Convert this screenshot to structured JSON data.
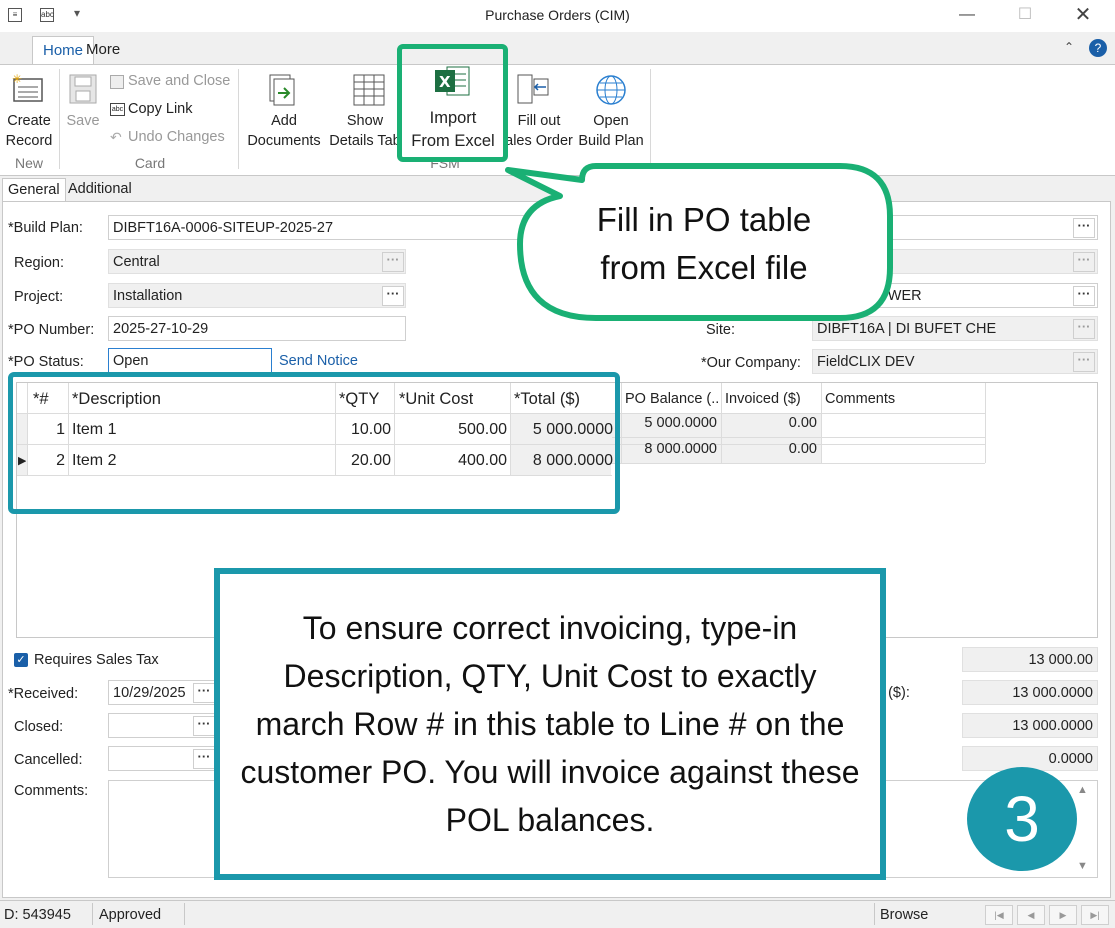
{
  "window": {
    "title": "Purchase Orders (CIM)"
  },
  "ribbon": {
    "tabs": [
      "Home",
      "More"
    ],
    "buttons": {
      "create_record": "Create\nRecord",
      "save": "Save",
      "save_and_close": "Save and Close",
      "copy_link": "Copy Link",
      "undo_changes": "Undo Changes",
      "add_documents": "Add\nDocuments",
      "show_details_table": "Show\nDetails Tab",
      "import_from_excel": "Import\nFrom Excel",
      "fill_out_sales_order": "Fill out\nales Order",
      "open_build_plan": "Open\nBuild Plan"
    },
    "groups": {
      "new": "New",
      "card": "Card",
      "fsm": "FSM"
    }
  },
  "form_tabs": [
    "General",
    "Additional"
  ],
  "form": {
    "build_plan_label": "*Build Plan:",
    "build_plan_value": "DIBFT16A-0006-SITEUP-2025-27",
    "region_label": "Region:",
    "region_value": "Central",
    "project_label": "Project:",
    "project_value": "Installation",
    "po_number_label": "*PO Number:",
    "po_number_value": "2025-27-10-29",
    "po_status_label": "*PO Status:",
    "po_status_value": "Open",
    "send_notice": "Send Notice",
    "partial_right_value": "AN TOWER",
    "site_label": "Site:",
    "site_value": "DIBFT16A | DI BUFET CHE",
    "our_company_label": "*Our Company:",
    "our_company_value": "FieldCLIX DEV",
    "requires_sales_tax": "Requires Sales Tax",
    "received_label": "*Received:",
    "received_value": "10/29/2025",
    "closed_label": "Closed:",
    "cancelled_label": "Cancelled:",
    "comments_label": "Comments:",
    "totals": [
      "13 000.00",
      "13 000.0000",
      "13 000.0000",
      "0.0000"
    ],
    "partial_totals_label": "e ($):"
  },
  "grid": {
    "headers": [
      "*#",
      "*Description",
      "*QTY",
      "*Unit Cost",
      "*Total ($)",
      "PO Balance (...",
      "Invoiced ($)",
      "Comments"
    ],
    "rows": [
      {
        "num": "1",
        "description": "Item 1",
        "qty": "10.00",
        "unit_cost": "500.00",
        "total": "5 000.0000",
        "po_balance": "5 000.0000",
        "invoiced": "0.00",
        "comments": ""
      },
      {
        "num": "2",
        "description": "Item 2",
        "qty": "20.00",
        "unit_cost": "400.00",
        "total": "8 000.0000",
        "po_balance": "8 000.0000",
        "invoiced": "0.00",
        "comments": ""
      }
    ]
  },
  "callouts": {
    "import_bubble": "Fill in PO table\nfrom Excel file",
    "info_box": "To ensure correct invoicing, type-in Description, QTY, Unit Cost to exactly march Row # in this table to Line # on the customer PO. You will invoice against these POL balances.",
    "step_number": "3"
  },
  "statusbar": {
    "id": "D: 543945",
    "state": "Approved",
    "mode": "Browse"
  },
  "colors": {
    "teal": "#1b98ab",
    "green": "#1ab074",
    "accent": "#1a5fa8"
  }
}
